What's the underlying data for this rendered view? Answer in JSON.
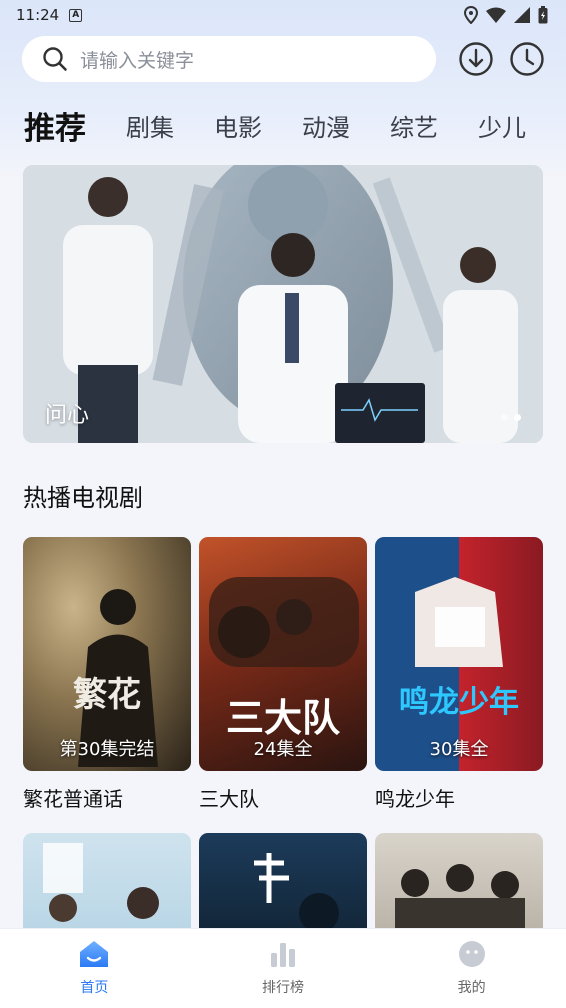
{
  "status_bar": {
    "time": "11:24",
    "notification_icon": "a-notification-icon",
    "icons": [
      "location-icon",
      "wifi-icon",
      "signal-icon",
      "battery-icon"
    ]
  },
  "search": {
    "placeholder": "请输入关键字",
    "icon": "search-icon"
  },
  "header_actions": {
    "download_icon": "download-icon",
    "history_icon": "history-clock-icon"
  },
  "tabs": [
    {
      "label": "推荐",
      "active": true
    },
    {
      "label": "剧集",
      "active": false
    },
    {
      "label": "电影",
      "active": false
    },
    {
      "label": "动漫",
      "active": false
    },
    {
      "label": "综艺",
      "active": false
    },
    {
      "label": "少儿",
      "active": false
    }
  ],
  "banner": {
    "title": "问心",
    "page_count": 2,
    "active_page": 2
  },
  "section": {
    "title": "热播电视剧",
    "items": [
      {
        "title": "繁花普通话",
        "badge": "第30集完结",
        "poster_text": "繁花"
      },
      {
        "title": "三大队",
        "badge": "24集全",
        "poster_text": "三大队"
      },
      {
        "title": "鸣龙少年",
        "badge": "30集全",
        "poster_text": "鸣龙少年"
      }
    ],
    "partial_row_count": 3
  },
  "bottom_nav": [
    {
      "label": "首页",
      "icon": "home-icon",
      "active": true
    },
    {
      "label": "排行榜",
      "icon": "ranking-icon",
      "active": false
    },
    {
      "label": "我的",
      "icon": "profile-icon",
      "active": false
    }
  ],
  "colors": {
    "accent": "#2b7af5",
    "background": "#f3f5fa",
    "text": "#111111"
  }
}
